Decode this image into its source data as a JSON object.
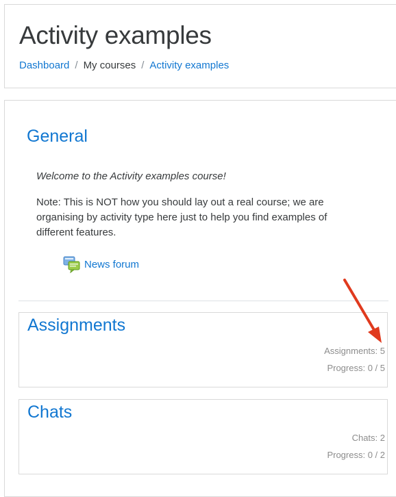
{
  "header": {
    "title": "Activity examples",
    "breadcrumb": [
      {
        "label": "Dashboard",
        "link": true
      },
      {
        "label": "My courses",
        "link": false
      },
      {
        "label": "Activity examples",
        "link": true
      }
    ],
    "separator": "/"
  },
  "general": {
    "title": "General",
    "welcome": "Welcome to the Activity examples course!",
    "note": "Note: This is NOT how you should lay out a real course; we are organising by activity type here just to help you find examples of different features.",
    "forum": {
      "label": "News forum",
      "icon": "forum-icon"
    }
  },
  "sections": [
    {
      "title": "Assignments",
      "count_text": "Assignments: 5",
      "progress_text": "Progress: 0 / 5"
    },
    {
      "title": "Chats",
      "count_text": "Chats: 2",
      "progress_text": "Progress: 0 / 2"
    }
  ],
  "colors": {
    "link": "#1177d1",
    "arrow": "#e03a1e",
    "muted": "#8c8c8c"
  }
}
